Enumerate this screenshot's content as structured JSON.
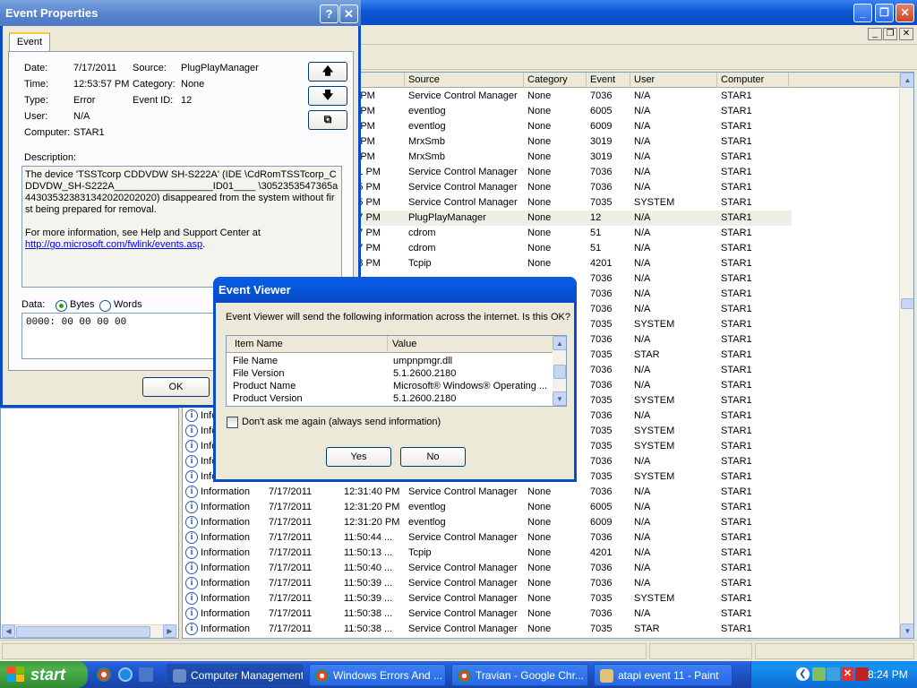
{
  "list": {
    "headers": {
      "time": "",
      "source": "Source",
      "category": "Category",
      "event": "Event",
      "user": "User",
      "computer": "Computer"
    },
    "rows": [
      {
        "time": ":29 PM",
        "source": "Service Control Manager",
        "category": "None",
        "event": "7036",
        "user": "N/A",
        "computer": "STAR1"
      },
      {
        "time": ":10 PM",
        "source": "eventlog",
        "category": "None",
        "event": "6005",
        "user": "N/A",
        "computer": "STAR1"
      },
      {
        "time": ":10 PM",
        "source": "eventlog",
        "category": "None",
        "event": "6009",
        "user": "N/A",
        "computer": "STAR1"
      },
      {
        "time": ":31 PM",
        "source": "MrxSmb",
        "category": "None",
        "event": "3019",
        "user": "N/A",
        "computer": "STAR1"
      },
      {
        "time": ":25 PM",
        "source": "MrxSmb",
        "category": "None",
        "event": "3019",
        "user": "N/A",
        "computer": "STAR1"
      },
      {
        "time": "9:01 PM",
        "source": "Service Control Manager",
        "category": "None",
        "event": "7036",
        "user": "N/A",
        "computer": "STAR1"
      },
      {
        "time": "8:55 PM",
        "source": "Service Control Manager",
        "category": "None",
        "event": "7036",
        "user": "N/A",
        "computer": "STAR1"
      },
      {
        "time": "8:55 PM",
        "source": "Service Control Manager",
        "category": "None",
        "event": "7035",
        "user": "SYSTEM",
        "computer": "STAR1"
      },
      {
        "time": "3:57 PM",
        "source": "PlugPlayManager",
        "category": "None",
        "event": "12",
        "user": "N/A",
        "computer": "STAR1"
      },
      {
        "time": "3:57 PM",
        "source": "cdrom",
        "category": "None",
        "event": "51",
        "user": "N/A",
        "computer": "STAR1"
      },
      {
        "time": "3:57 PM",
        "source": "cdrom",
        "category": "None",
        "event": "51",
        "user": "N/A",
        "computer": "STAR1"
      },
      {
        "time": "1:18 PM",
        "source": "Tcpip",
        "category": "None",
        "event": "4201",
        "user": "N/A",
        "computer": "STAR1"
      },
      {
        "time": "",
        "source": "",
        "category": "",
        "event": "7036",
        "user": "N/A",
        "computer": "STAR1"
      },
      {
        "time": "",
        "source": "",
        "category": "",
        "event": "7036",
        "user": "N/A",
        "computer": "STAR1"
      },
      {
        "time": "",
        "source": "",
        "category": "",
        "event": "7036",
        "user": "N/A",
        "computer": "STAR1"
      },
      {
        "time": "",
        "source": "",
        "category": "",
        "event": "7035",
        "user": "SYSTEM",
        "computer": "STAR1"
      },
      {
        "time": "",
        "source": "",
        "category": "",
        "event": "7036",
        "user": "N/A",
        "computer": "STAR1"
      },
      {
        "time": "",
        "source": "",
        "category": "",
        "event": "7035",
        "user": "STAR",
        "computer": "STAR1"
      },
      {
        "time": "",
        "source": "",
        "category": "",
        "event": "7036",
        "user": "N/A",
        "computer": "STAR1"
      },
      {
        "time": "",
        "source": "",
        "category": "",
        "event": "7036",
        "user": "N/A",
        "computer": "STAR1"
      },
      {
        "time": "",
        "source": "",
        "category": "",
        "event": "7035",
        "user": "SYSTEM",
        "computer": "STAR1"
      },
      {
        "type": "Infor",
        "time": "",
        "source": "",
        "category": "",
        "event": "7036",
        "user": "N/A",
        "computer": "STAR1"
      },
      {
        "type": "Infor",
        "time": "",
        "source": "",
        "category": "",
        "event": "7035",
        "user": "SYSTEM",
        "computer": "STAR1"
      },
      {
        "type": "Infor",
        "time": "",
        "source": "",
        "category": "",
        "event": "7035",
        "user": "SYSTEM",
        "computer": "STAR1"
      },
      {
        "type": "Infor",
        "time": "",
        "source": "",
        "category": "",
        "event": "7036",
        "user": "N/A",
        "computer": "STAR1"
      },
      {
        "type": "Infor",
        "time": "",
        "source": "",
        "category": "",
        "event": "7035",
        "user": "SYSTEM",
        "computer": "STAR1"
      },
      {
        "type": "Information",
        "date": "7/17/2011",
        "time": "12:31:40 PM",
        "source": "Service Control Manager",
        "category": "None",
        "event": "7036",
        "user": "N/A",
        "computer": "STAR1"
      },
      {
        "type": "Information",
        "date": "7/17/2011",
        "time": "12:31:20 PM",
        "source": "eventlog",
        "category": "None",
        "event": "6005",
        "user": "N/A",
        "computer": "STAR1"
      },
      {
        "type": "Information",
        "date": "7/17/2011",
        "time": "12:31:20 PM",
        "source": "eventlog",
        "category": "None",
        "event": "6009",
        "user": "N/A",
        "computer": "STAR1"
      },
      {
        "type": "Information",
        "date": "7/17/2011",
        "time": "11:50:44 ...",
        "source": "Service Control Manager",
        "category": "None",
        "event": "7036",
        "user": "N/A",
        "computer": "STAR1"
      },
      {
        "type": "Information",
        "date": "7/17/2011",
        "time": "11:50:13 ...",
        "source": "Tcpip",
        "category": "None",
        "event": "4201",
        "user": "N/A",
        "computer": "STAR1"
      },
      {
        "type": "Information",
        "date": "7/17/2011",
        "time": "11:50:40 ...",
        "source": "Service Control Manager",
        "category": "None",
        "event": "7036",
        "user": "N/A",
        "computer": "STAR1"
      },
      {
        "type": "Information",
        "date": "7/17/2011",
        "time": "11:50:39 ...",
        "source": "Service Control Manager",
        "category": "None",
        "event": "7036",
        "user": "N/A",
        "computer": "STAR1"
      },
      {
        "type": "Information",
        "date": "7/17/2011",
        "time": "11:50:39 ...",
        "source": "Service Control Manager",
        "category": "None",
        "event": "7035",
        "user": "SYSTEM",
        "computer": "STAR1"
      },
      {
        "type": "Information",
        "date": "7/17/2011",
        "time": "11:50:38 ...",
        "source": "Service Control Manager",
        "category": "None",
        "event": "7036",
        "user": "N/A",
        "computer": "STAR1"
      },
      {
        "type": "Information",
        "date": "7/17/2011",
        "time": "11:50:38 ...",
        "source": "Service Control Manager",
        "category": "None",
        "event": "7035",
        "user": "STAR",
        "computer": "STAR1"
      }
    ]
  },
  "props": {
    "title": "Event Properties",
    "help_glyph": "?",
    "close_glyph": "✕",
    "tab_label": "Event",
    "date_label": "Date:",
    "date_value": "7/17/2011",
    "source_label": "Source:",
    "source_value": "PlugPlayManager",
    "time_label": "Time:",
    "time_value": "12:53:57 PM",
    "category_label": "Category:",
    "category_value": "None",
    "type_label": "Type:",
    "type_value": "Error",
    "eventid_label": "Event ID:",
    "eventid_value": "12",
    "user_label": "User:",
    "user_value": "N/A",
    "computer_label": "Computer:",
    "computer_value": "STAR1",
    "description_label": "Description:",
    "description_text": "The device 'TSSTcorp CDDVDW SH-S222A' (IDE \\CdRomTSSTcorp_CDDVDW_SH-S222A__________________ID01____ \\3052353547365a443035323831342020202020) disappeared from the system without first being prepared for removal.",
    "description_help": "For more information, see Help and Support Center at",
    "description_link": "http://go.microsoft.com/fwlink/events.asp",
    "description_end": ".",
    "data_label": "Data:",
    "bytes_label": "Bytes",
    "words_label": "Words",
    "data_value": "0000: 00 00 00 00",
    "ok_label": "OK",
    "up_glyph": "🡅",
    "down_glyph": "🡇",
    "copy_glyph": "⧉"
  },
  "ev_dialog": {
    "title": "Event Viewer",
    "message": "Event Viewer will send the following information across the internet. Is this OK?",
    "col_item": "Item Name",
    "col_value": "Value",
    "rows": [
      {
        "name": "File Name",
        "value": "umpnpmgr.dll"
      },
      {
        "name": "File Version",
        "value": "5.1.2600.2180"
      },
      {
        "name": "Product Name",
        "value": "Microsoft® Windows® Operating ..."
      },
      {
        "name": "Product Version",
        "value": "5.1.2600.2180"
      }
    ],
    "checkbox_label": "Don't ask me again (always send information)",
    "yes_label": "Yes",
    "no_label": "No"
  },
  "taskbar": {
    "start_label": "start",
    "tasks": [
      {
        "label": "Computer Management"
      },
      {
        "label": "Windows Errors And ..."
      },
      {
        "label": "Travian - Google Chr..."
      },
      {
        "label": "atapi event 11 - Paint"
      }
    ],
    "clock": "8:24 PM"
  },
  "colors": {
    "xp_blue": "#0a4cc4",
    "start_green": "#3c9a3c",
    "selected_row": "#f0efe6"
  }
}
